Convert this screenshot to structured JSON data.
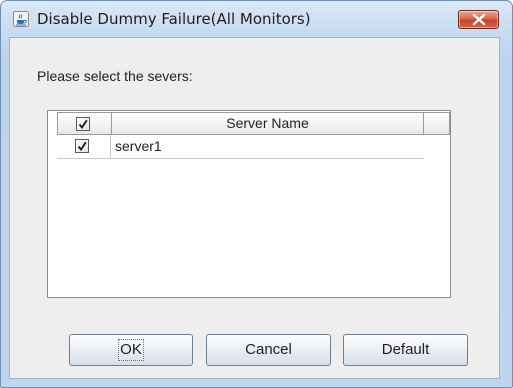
{
  "window": {
    "title": "Disable Dummy Failure(All Monitors)",
    "icon": "java-cup-icon",
    "close_icon": "close-icon"
  },
  "dialog": {
    "prompt": "Please select the severs:"
  },
  "table": {
    "columns": [
      {
        "type": "checkbox",
        "checked": true
      },
      {
        "label": "Server Name"
      }
    ],
    "rows": [
      {
        "checked": true,
        "name": "server1"
      }
    ]
  },
  "buttons": {
    "ok": "OK",
    "cancel": "Cancel",
    "default": "Default"
  },
  "colors": {
    "close_button": "#d9684e",
    "titlebar": "#c9dcf1",
    "content_bg": "#eeeeee"
  }
}
